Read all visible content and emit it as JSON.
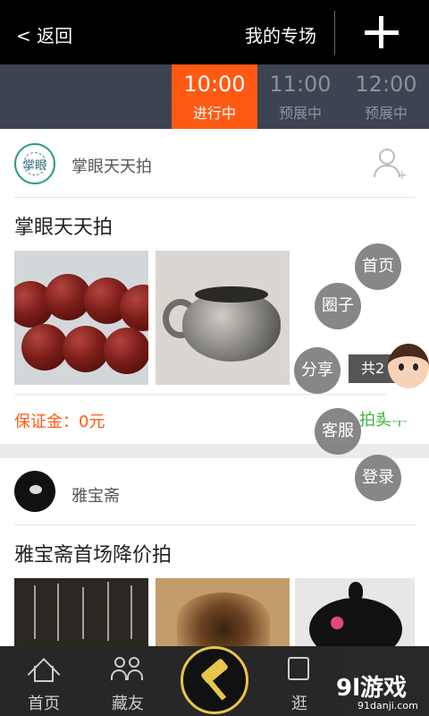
{
  "header": {
    "back_label": "< 返回",
    "my_special_label": "我的专场"
  },
  "time_tabs": [
    {
      "time": "10:00",
      "status": "进行中",
      "active": true
    },
    {
      "time": "11:00",
      "status": "预展中",
      "active": false
    },
    {
      "time": "12:00",
      "status": "预展中",
      "active": false
    }
  ],
  "cards": [
    {
      "shop_name": "掌眼天天拍",
      "avatar_text": "掌眼",
      "title": "掌眼天天拍",
      "deposit": "保证金：0元",
      "status": "拍卖中"
    },
    {
      "shop_name": "雅宝斋",
      "title": "雅宝斋首场降价拍"
    }
  ],
  "floating_menu": {
    "home": "首页",
    "circle": "圈子",
    "share": "分享",
    "service": "客服",
    "login": "登录",
    "total_prefix": "共2"
  },
  "bottom_nav": {
    "home": "首页",
    "friends": "藏友",
    "third": "逛",
    "watermark_big": "9l游戏",
    "watermark_small": "91danji.com"
  },
  "colors": {
    "accent": "#ff5a14",
    "tab_bar": "#3c4451",
    "status_green": "#3bb33b",
    "hammer_gold": "#e8c64a"
  }
}
